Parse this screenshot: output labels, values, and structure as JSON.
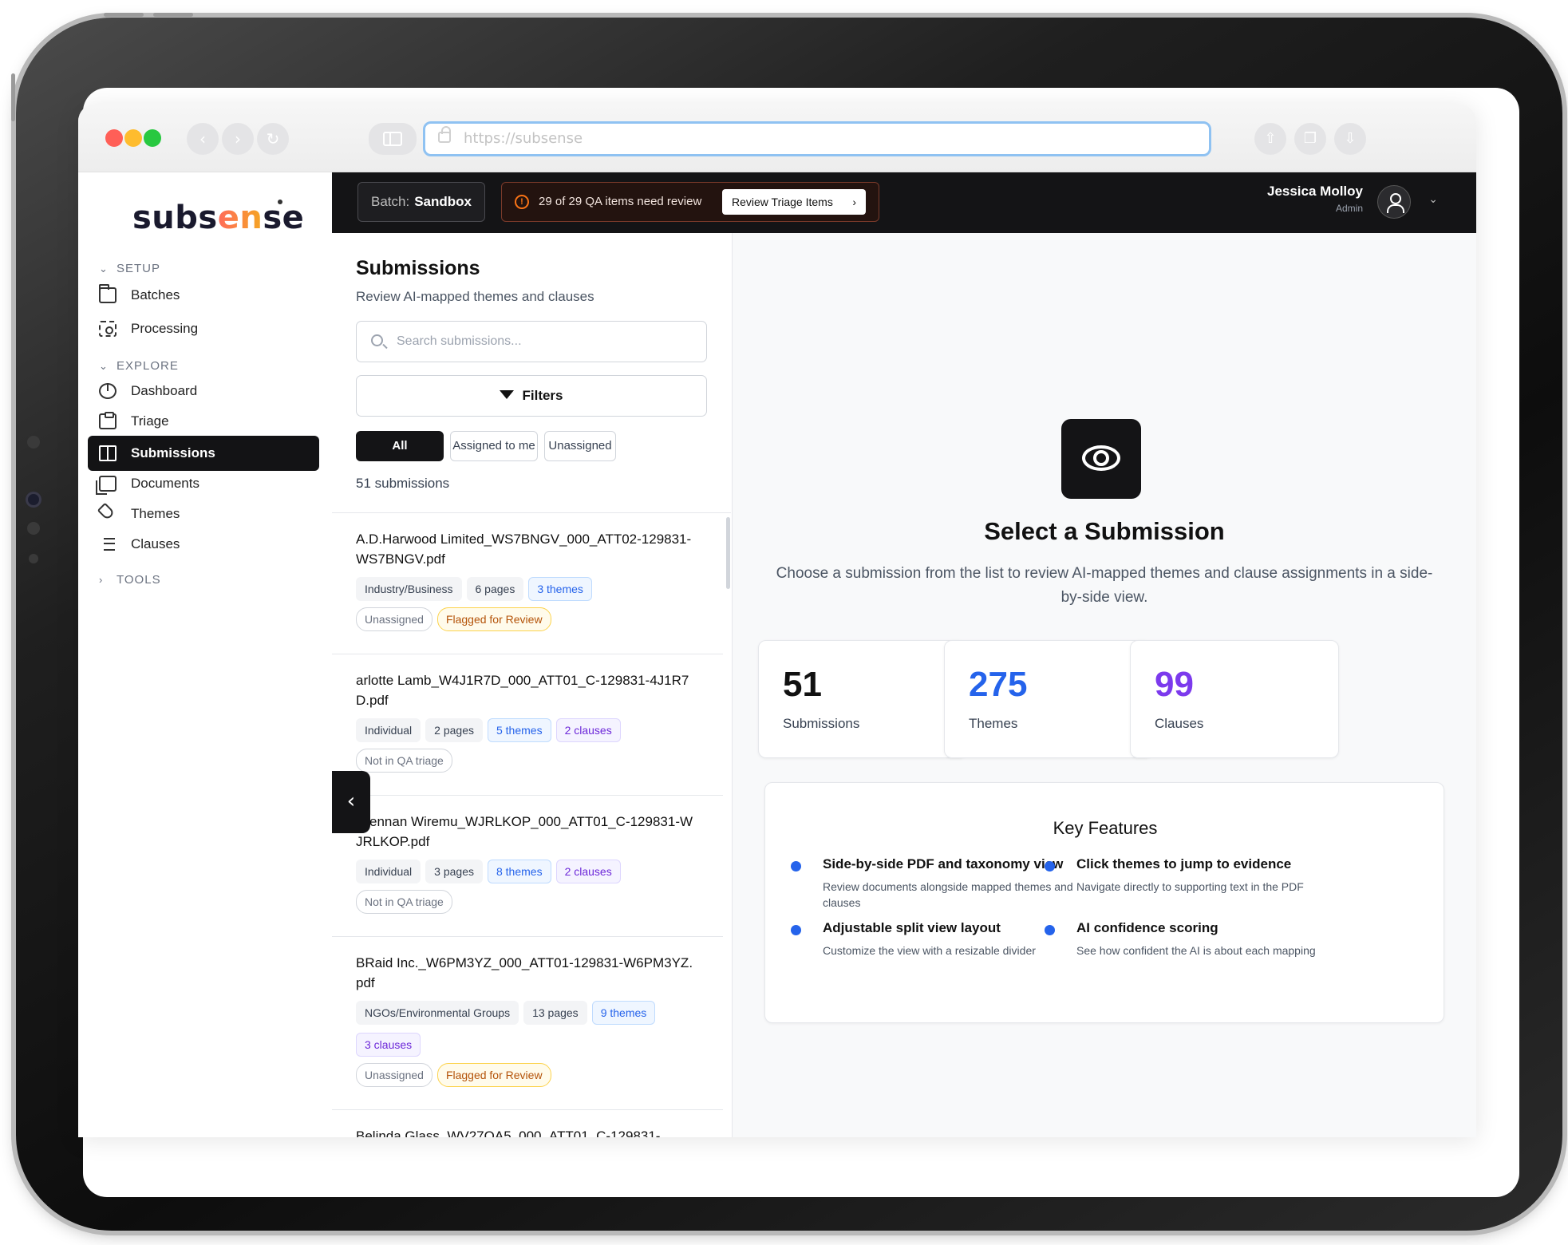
{
  "browser": {
    "url_placeholder": "https://subsense",
    "traffic_colors": [
      "#ff5f57",
      "#febc2e",
      "#28c840"
    ]
  },
  "brand": {
    "logo_text_start": "subs",
    "logo_text_accent": "en",
    "logo_text_end": "se"
  },
  "sidebar": {
    "sections": [
      {
        "label": "SETUP",
        "chevron": "⌄"
      },
      {
        "label": "EXPLORE",
        "chevron": "⌄"
      },
      {
        "label": "TOOLS",
        "chevron": "›"
      }
    ],
    "items": [
      {
        "label": "Batches",
        "icon": "folder-icon"
      },
      {
        "label": "Processing",
        "icon": "scan-icon"
      },
      {
        "label": "Dashboard",
        "icon": "pie-chart-icon"
      },
      {
        "label": "Triage",
        "icon": "clipboard-icon"
      },
      {
        "label": "Submissions",
        "icon": "book-open-icon"
      },
      {
        "label": "Documents",
        "icon": "documents-icon"
      },
      {
        "label": "Themes",
        "icon": "tag-icon"
      },
      {
        "label": "Clauses",
        "icon": "list-icon"
      }
    ],
    "active_item": "Submissions"
  },
  "topbar": {
    "batch_label": "Batch:",
    "batch_value": "Sandbox",
    "alert_text": "29 of 29 QA items need review",
    "alert_icon": "!",
    "triage_button": "Review Triage Items",
    "triage_arrow": "›",
    "user_name": "Jessica Molloy",
    "user_role": "Admin",
    "user_chevron": "⌄"
  },
  "submissions": {
    "title": "Submissions",
    "subtitle": "Review AI-mapped themes and clauses",
    "search_placeholder": "Search submissions...",
    "filters_label": "Filters",
    "segments": [
      "All submissions",
      "Assigned to me",
      "Unassigned"
    ],
    "count_text": "51 submissions",
    "items": [
      {
        "name": "A.D.Harwood Limited_WS7BNGV_000_ATT02-129831-WS7BNGV.pdf",
        "tags": [
          {
            "text": "Industry/Business",
            "style": "grey"
          },
          {
            "text": "6 pages",
            "style": "grey"
          },
          {
            "text": "3 themes",
            "style": "blue"
          }
        ],
        "status": [
          {
            "text": "Unassigned",
            "style": "out"
          },
          {
            "text": "Flagged for Review",
            "style": "amber"
          }
        ]
      },
      {
        "name": "arlotte Lamb_W4J1R7D_000_ATT01_C-129831-4J1R7D.pdf",
        "tags": [
          {
            "text": "Individual",
            "style": "grey"
          },
          {
            "text": "2 pages",
            "style": "grey"
          },
          {
            "text": "5 themes",
            "style": "blue"
          },
          {
            "text": "2 clauses",
            "style": "purple"
          }
        ],
        "status": [
          {
            "text": "Not in QA triage",
            "style": "out"
          }
        ]
      },
      {
        "name": "Brennan Wiremu_WJRLKOP_000_ATT01_C-129831-WJRLKOP.pdf",
        "tags": [
          {
            "text": "Individual",
            "style": "grey"
          },
          {
            "text": "3 pages",
            "style": "grey"
          },
          {
            "text": "8 themes",
            "style": "blue"
          },
          {
            "text": "2 clauses",
            "style": "purple"
          }
        ],
        "status": [
          {
            "text": "Not in QA triage",
            "style": "out"
          }
        ]
      },
      {
        "name": "BRaid Inc._W6PM3YZ_000_ATT01-129831-W6PM3YZ.pdf",
        "tags": [
          {
            "text": "NGOs/Environmental Groups",
            "style": "grey"
          },
          {
            "text": "13 pages",
            "style": "grey"
          },
          {
            "text": "9 themes",
            "style": "blue"
          },
          {
            "text": "3 clauses",
            "style": "purple"
          }
        ],
        "status": [
          {
            "text": "Unassigned",
            "style": "out"
          },
          {
            "text": "Flagged for Review",
            "style": "amber"
          }
        ]
      },
      {
        "name": "Belinda Glass_WV27QA5_000_ATT01_C-129831-",
        "tags": [],
        "status": []
      }
    ],
    "collapse_icon": "‹"
  },
  "main": {
    "title": "Select a Submission",
    "description": "Choose a submission from the list to review AI-mapped themes and clause assignments in a side-by-side view.",
    "stats": [
      {
        "value": "51",
        "label": "Submissions",
        "color": "#111111"
      },
      {
        "value": "275",
        "label": "Themes",
        "color": "#2563eb"
      },
      {
        "value": "99",
        "label": "Clauses",
        "color": "#7c3aed"
      }
    ],
    "features_title": "Key Features",
    "features": [
      {
        "title": "Side-by-side PDF and taxonomy view",
        "desc": "Review documents alongside mapped themes and clauses"
      },
      {
        "title": "Click themes to jump to evidence",
        "desc": "Navigate directly to supporting text in the PDF"
      },
      {
        "title": "Adjustable split view layout",
        "desc": "Customize the view with a resizable divider"
      },
      {
        "title": "AI confidence scoring",
        "desc": "See how confident the AI is about each mapping"
      }
    ]
  }
}
